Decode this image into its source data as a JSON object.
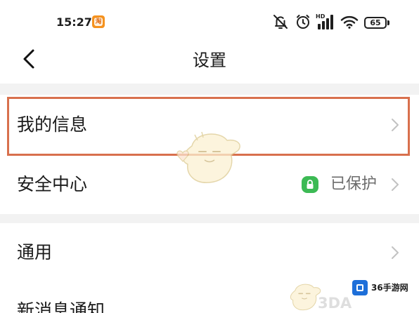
{
  "status_bar": {
    "time": "15:27",
    "app_badge": {
      "icon": "taobao-app-icon",
      "glyph": "淘"
    },
    "icons": [
      "bell-mute-icon",
      "alarm-clock-icon",
      "signal-icon",
      "wifi-icon",
      "battery-icon"
    ],
    "network_label": "HD",
    "battery_level": "65"
  },
  "header": {
    "back_icon": "chevron-left-icon",
    "title": "设置"
  },
  "sections": [
    {
      "items": [
        {
          "label": "我的信息",
          "icon": "chevron-right-icon",
          "highlighted": true
        },
        {
          "label": "安全中心",
          "status_icon": "lock-icon",
          "status_text": "已保护",
          "icon": "chevron-right-icon"
        }
      ]
    },
    {
      "items": [
        {
          "label": "通用",
          "icon": "chevron-right-icon"
        },
        {
          "label": "新消息通知"
        }
      ]
    }
  ],
  "watermarks": {
    "mascot_icon": "mascot-watermark-icon",
    "faint_text": "3DA",
    "logo_icon": "36sy-logo-icon",
    "logo_text": "36手游网"
  },
  "colors": {
    "highlight_border": "#d8704d",
    "lock_green": "#3cba54",
    "taobao_orange": "#f5921e",
    "logo_blue": "#1e6fd9",
    "separator": "#f2f2f2",
    "chevron": "#c2c2c2",
    "status_text": "#6b6b6b"
  }
}
